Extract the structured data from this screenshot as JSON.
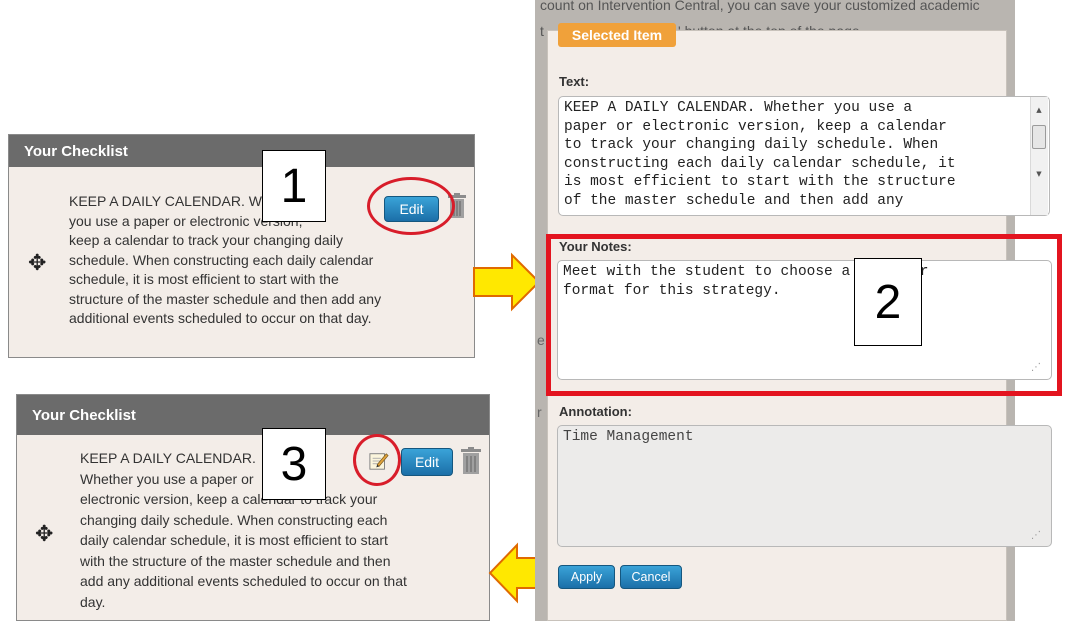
{
  "checklist_top": {
    "heading": "Your Checklist",
    "lines": [
      "KEEP A DAILY CALENDAR. Whether",
      "you use a paper or electronic version,",
      "keep a calendar to track your changing daily",
      "schedule. When constructing each daily calendar",
      "schedule, it is most efficient to start with the",
      "structure of the master schedule and then add any",
      "additional events scheduled to occur on that day."
    ],
    "edit_label": "Edit"
  },
  "checklist_bottom": {
    "heading": "Your Checklist",
    "lines": [
      "KEEP A DAILY CALENDAR.",
      "Whether you use a paper or",
      "electronic version, keep a calendar to track your",
      "changing daily schedule. When constructing each",
      "daily calendar schedule, it is most efficient to start",
      "with the structure of the master schedule and then",
      "add any additional events scheduled to occur on that",
      "day."
    ],
    "edit_label": "Edit"
  },
  "callouts": {
    "one": "1",
    "two": "2",
    "three": "3"
  },
  "backdrop_text": {
    "line1": "count on Intervention Central, you can save your customized academic",
    "line2": "' button at the top of the page."
  },
  "dialog": {
    "tab": "Selected Item",
    "text_label": "Text:",
    "text_value": "KEEP A DAILY CALENDAR. Whether you use a\npaper or electronic version, keep a calendar\nto track your changing daily schedule. When\nconstructing each daily calendar schedule, it\nis most efficient to start with the structure\nof the master schedule and then add any",
    "notes_label": "Your Notes:",
    "notes_value": "Meet with the student to choose a calendar\nformat for this strategy.",
    "annotation_label": "Annotation:",
    "annotation_value": "Time Management",
    "apply_label": "Apply",
    "cancel_label": "Cancel"
  },
  "icons": {
    "move": "move-arrows-icon",
    "trash": "trash-icon",
    "note": "note-pencil-icon",
    "arrows": "yellow-arrow-icon"
  },
  "colors": {
    "header": "#6b6b6b",
    "panel": "#f3ede8",
    "button": "#1b6fa8",
    "tab": "#f0a13a",
    "highlight": "#e3141f",
    "arrow": "#ffe800"
  }
}
